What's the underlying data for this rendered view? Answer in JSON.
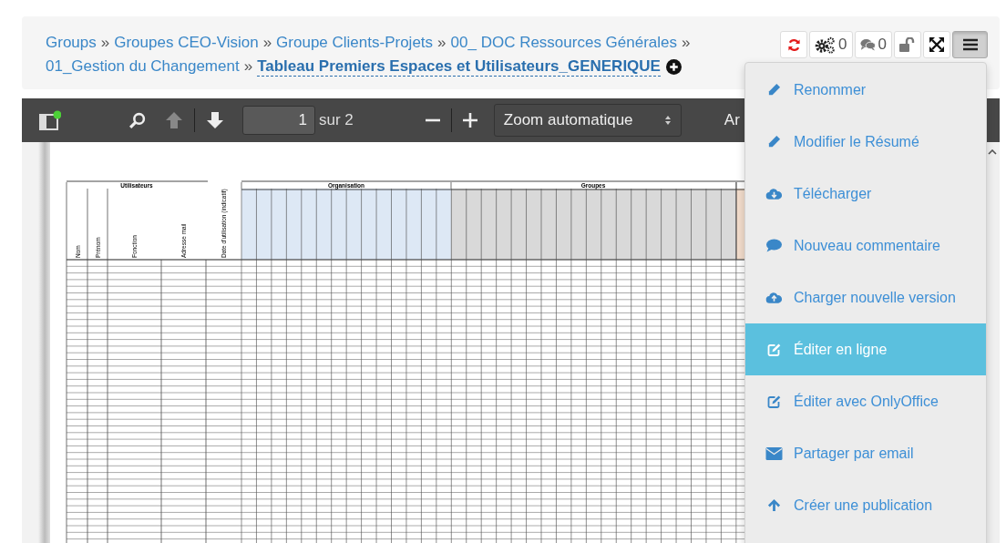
{
  "breadcrumb": [
    {
      "label": "Groups",
      "current": false
    },
    {
      "label": "Groupes CEO-Vision",
      "current": false
    },
    {
      "label": "Groupe Clients-Projets",
      "current": false
    },
    {
      "label": "00_ DOC Ressources Générales",
      "current": false
    },
    {
      "label": "01_Gestion du Changement",
      "current": false
    },
    {
      "label": "Tableau Premiers Espaces et Utilisateurs_GENERIQUE",
      "current": true
    }
  ],
  "separator": "»",
  "actions": [
    {
      "kind": "refresh",
      "selected": false
    },
    {
      "kind": "tasks",
      "count": "0",
      "selected": false
    },
    {
      "kind": "comments",
      "count": "0",
      "selected": false
    },
    {
      "kind": "lock",
      "selected": false
    },
    {
      "kind": "fullscreen",
      "selected": false
    },
    {
      "kind": "menu",
      "selected": true
    }
  ],
  "viewer": {
    "page": "1",
    "page_total": "sur 2",
    "zoom": "Zoom automatique",
    "cut_label": "Ar"
  },
  "sheet": {
    "groups": [
      "Utilisateurs",
      "Organisation",
      "Groupes"
    ],
    "columns": [
      "Nom",
      "Prénom",
      "Fonction",
      "Adresse mail",
      "Date d'utilisation (indicatif)"
    ]
  },
  "menu": [
    {
      "kind": "pencil",
      "label": "Renommer",
      "selected": false
    },
    {
      "kind": "pencil",
      "label": "Modifier le Résumé",
      "selected": false
    },
    {
      "kind": "cloud-download",
      "label": "Télécharger",
      "selected": false
    },
    {
      "kind": "comment",
      "label": "Nouveau commentaire",
      "selected": false
    },
    {
      "kind": "cloud-upload",
      "label": "Charger nouvelle version",
      "selected": false
    },
    {
      "kind": "edit",
      "label": "Éditer en ligne",
      "selected": true
    },
    {
      "kind": "edit",
      "label": "Éditer avec OnlyOffice",
      "selected": false
    },
    {
      "kind": "envelope",
      "label": "Partager par email",
      "selected": false
    },
    {
      "kind": "arrow-up",
      "label": "Créer une publication",
      "selected": false
    }
  ]
}
